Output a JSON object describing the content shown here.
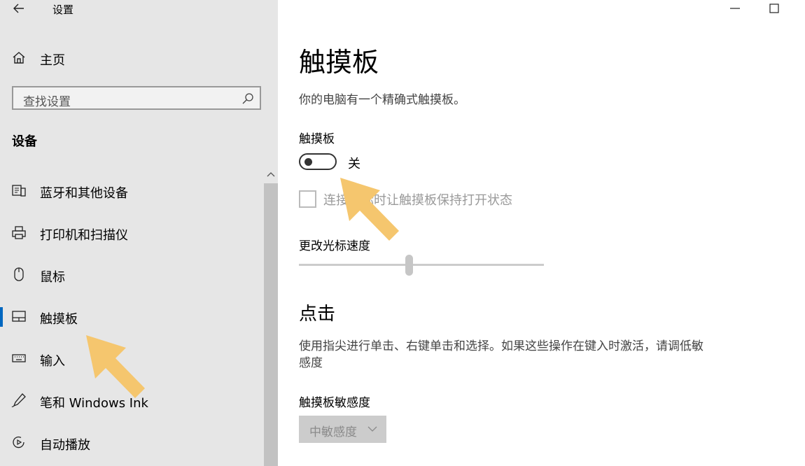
{
  "window": {
    "title": "设置",
    "controls": [
      "minimize-icon",
      "maximize-icon"
    ]
  },
  "sidebar": {
    "home_label": "主页",
    "search_placeholder": "查找设置",
    "section_title": "设备",
    "items": [
      {
        "label": "蓝牙和其他设备",
        "icon": "bluetooth-devices-icon"
      },
      {
        "label": "打印机和扫描仪",
        "icon": "printer-icon"
      },
      {
        "label": "鼠标",
        "icon": "mouse-icon"
      },
      {
        "label": "触摸板",
        "icon": "touchpad-icon",
        "selected": true
      },
      {
        "label": "输入",
        "icon": "keyboard-icon"
      },
      {
        "label": "笔和 Windows Ink",
        "icon": "pen-icon"
      },
      {
        "label": "自动播放",
        "icon": "autoplay-icon"
      }
    ]
  },
  "main": {
    "title": "触摸板",
    "description": "你的电脑有一个精确式触摸板。",
    "touchpad_toggle": {
      "label": "触摸板",
      "state_text": "关",
      "on": false
    },
    "keep_on_checkbox": {
      "label": "连接鼠标时让触摸板保持打开状态",
      "checked": false,
      "enabled": false
    },
    "cursor_speed": {
      "label": "更改光标速度",
      "level_fraction": 0.45
    },
    "taps": {
      "heading": "点击",
      "description": "使用指尖进行单击、右键单击和选择。如果这些操作在键入时激活，请调低敏感度",
      "sensitivity_label": "触摸板敏感度",
      "sensitivity_value": "中敏感度"
    }
  },
  "annotations": {
    "arrow_color": "#f5c66e"
  },
  "accent_color": "#0067c0"
}
